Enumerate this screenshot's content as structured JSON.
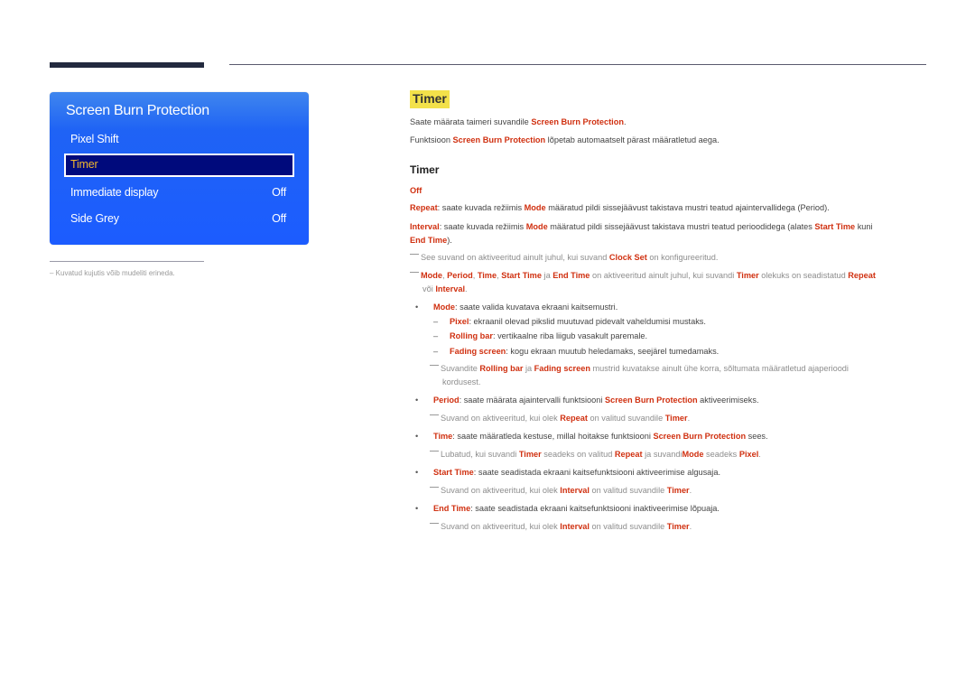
{
  "osd": {
    "title": "Screen Burn Protection",
    "items": [
      {
        "label": "Pixel Shift",
        "value": ""
      },
      {
        "label": "Timer",
        "value": "",
        "selected": true
      },
      {
        "label": "Immediate display",
        "value": "Off"
      },
      {
        "label": "Side Grey",
        "value": "Off"
      }
    ]
  },
  "footnote": "– Kuvatud kujutis võib mudeliti erineda.",
  "content": {
    "heading": "Timer",
    "intro1": {
      "pre": "Saate määrata taimeri suvandile ",
      "hl": "Screen Burn Protection",
      "post": "."
    },
    "intro2": {
      "pre": "Funktsioon ",
      "hl": "Screen Burn Protection",
      "post": " lõpetab automaatselt pärast määratletud aega."
    },
    "subheading": "Timer",
    "off_label": "Off",
    "repeat": {
      "hl": "Repeat",
      "t1": ": saate kuvada režiimis ",
      "hl2": "Mode",
      "t2": " määratud pildi sissejäävust takistava mustri teatud ajaintervallidega (Period)."
    },
    "interval": {
      "hl": "Interval",
      "t1": ": saate kuvada režiimis ",
      "hl2": "Mode",
      "t2": " määratud pildi sissejäävust takistava mustri teatud perioodidega (alates ",
      "hl3": "Start Time",
      "t3": " kuni",
      "hl4": "End Time",
      "t4": ")."
    },
    "note1": {
      "t1": "See suvand on aktiveeritud ainult juhul, kui suvand ",
      "hl": "Clock Set",
      "t2": " on konfigureeritud."
    },
    "note2": {
      "hl1": "Mode",
      "s1": ", ",
      "hl2": "Period",
      "s2": ", ",
      "hl3": "Time",
      "s3": ", ",
      "hl4": "Start Time",
      "s4": " ja ",
      "hl5": "End Time",
      "t1": " on aktiveeritud ainult juhul, kui suvandi ",
      "hl6": "Timer",
      "t2": " olekuks on seadistatud ",
      "hl7": "Repeat",
      "t3": "või ",
      "hl8": "Interval",
      "t4": "."
    },
    "mode": {
      "hl": "Mode",
      "t": ": saate valida kuvatava ekraani kaitsemustri."
    },
    "pixel": {
      "hl": "Pixel",
      "t": ": ekraanil olevad pikslid muutuvad pidevalt vaheldumisi mustaks."
    },
    "rolling": {
      "hl": "Rolling bar",
      "t": ": vertikaalne riba liigub vasakult paremale."
    },
    "fading": {
      "hl": "Fading screen",
      "t": ": kogu ekraan muutub heledamaks, seejärel tumedamaks."
    },
    "note3": {
      "t1": "Suvandite ",
      "hl1": "Rolling bar",
      "t2": " ja ",
      "hl2": "Fading screen",
      "t3": " mustrid kuvatakse ainult ühe korra, sõltumata määratletud ajaperioodi",
      "t4": "kordusest."
    },
    "period": {
      "hl": "Period",
      "t1": ": saate määrata ajaintervalli funktsiooni ",
      "hl2": "Screen Burn Protection",
      "t2": " aktiveerimiseks."
    },
    "note4": {
      "t1": "Suvand on aktiveeritud, kui olek ",
      "hl1": "Repeat",
      "t2": " on valitud suvandile ",
      "hl2": "Timer",
      "t3": "."
    },
    "time": {
      "hl": "Time",
      "t1": ": saate määratleda kestuse, millal hoitakse funktsiooni ",
      "hl2": "Screen Burn Protection",
      "t2": " sees."
    },
    "note5": {
      "t1": "Lubatud, kui suvandi ",
      "hl1": "Timer",
      "t2": " seadeks on valitud ",
      "hl2": "Repeat",
      "t3": " ja suvandi",
      "hl3": "Mode",
      "t4": " seadeks ",
      "hl4": "Pixel",
      "t5": "."
    },
    "start": {
      "hl": "Start Time",
      "t": ": saate seadistada ekraani kaitsefunktsiooni aktiveerimise algusaja."
    },
    "note6": {
      "t1": "Suvand on aktiveeritud, kui olek ",
      "hl1": "Interval",
      "t2": " on valitud suvandile ",
      "hl2": "Timer",
      "t3": "."
    },
    "end": {
      "hl": "End Time",
      "t": ": saate seadistada ekraani kaitsefunktsiooni inaktiveerimise lõpuaja."
    },
    "note7": {
      "t1": "Suvand on aktiveeritud, kui olek ",
      "hl1": "Interval",
      "t2": " on valitud suvandile ",
      "hl2": "Timer",
      "t3": "."
    }
  }
}
